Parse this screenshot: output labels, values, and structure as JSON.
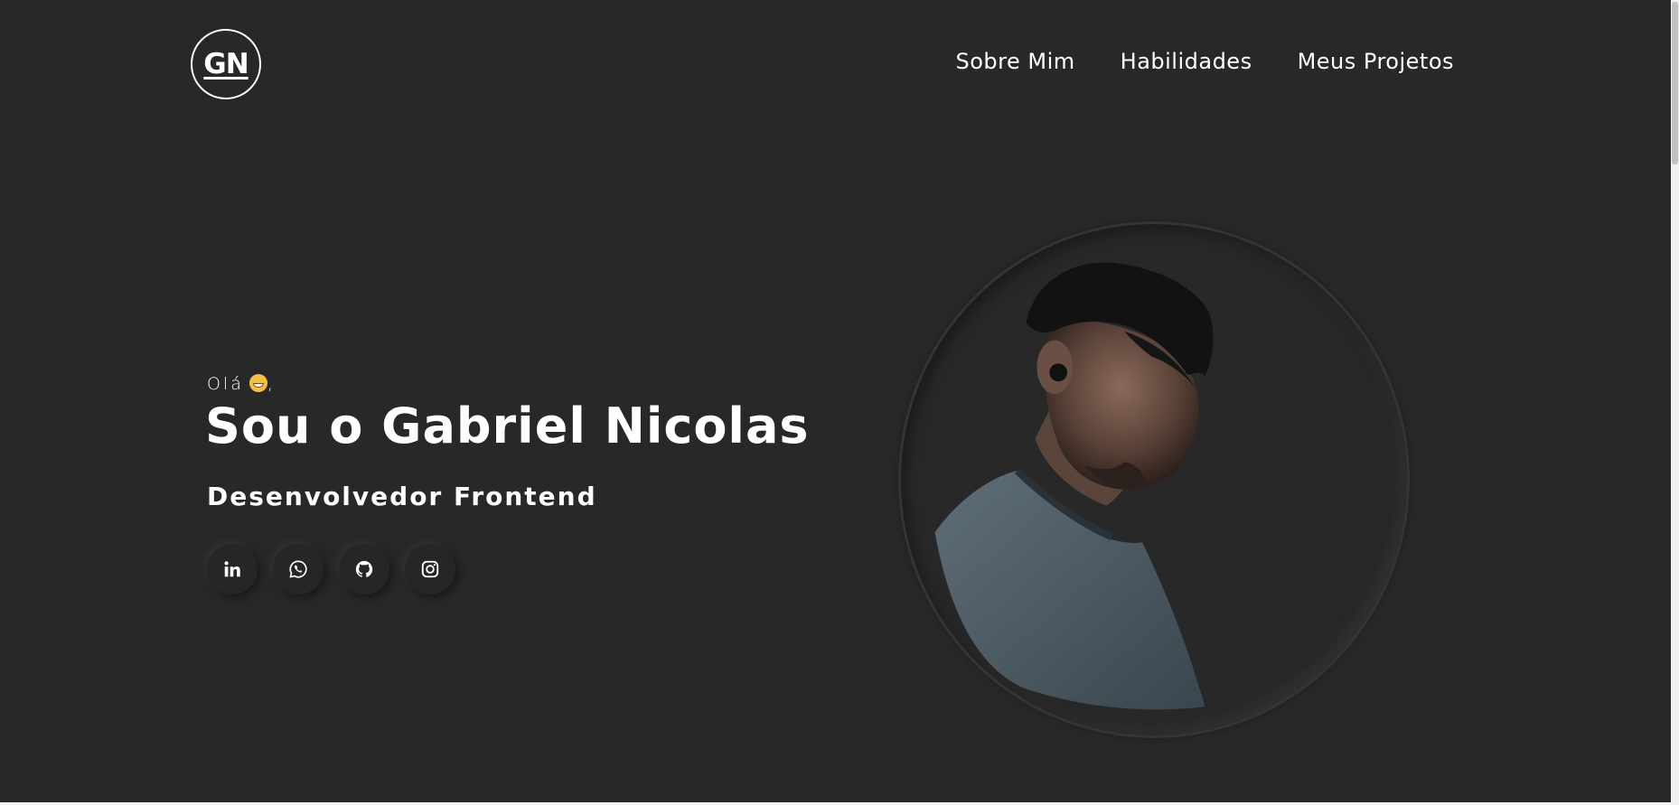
{
  "header": {
    "logo_text": "GN",
    "nav": [
      {
        "label": "Sobre Mim"
      },
      {
        "label": "Habilidades"
      },
      {
        "label": "Meus Projetos"
      }
    ]
  },
  "hero": {
    "greeting": "Olá",
    "greeting_suffix": ",",
    "greeting_emoji": "grinning-face-icon",
    "name": "Sou o Gabriel Nicolas",
    "role": "Desenvolvedor Frontend",
    "socials": [
      {
        "icon": "linkedin-icon"
      },
      {
        "icon": "whatsapp-icon"
      },
      {
        "icon": "github-icon"
      },
      {
        "icon": "instagram-icon"
      }
    ]
  },
  "colors": {
    "background": "#282828",
    "text": "#ffffff"
  }
}
